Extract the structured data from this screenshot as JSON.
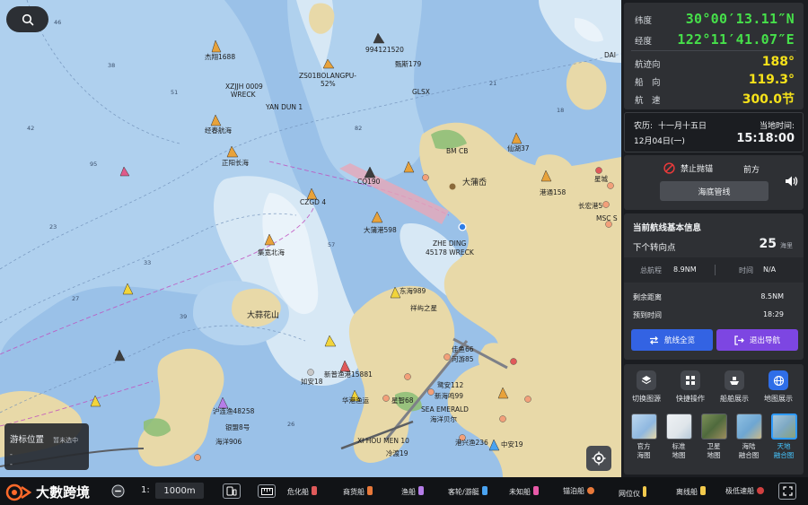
{
  "cursor_box": {
    "title": "游标位置",
    "status": "暂未选中",
    "line1": "-",
    "line2": "-"
  },
  "position": {
    "lat_label": "纬度",
    "lat_value": "30°00′13.11″N",
    "lon_label": "经度",
    "lon_value": "122°11′41.07″E"
  },
  "motion": {
    "track_label": "航迹向",
    "track_value": "188°",
    "heading_label": "船　向",
    "heading_value": "119.3°",
    "speed_label": "航　速",
    "speed_value": "300.0节"
  },
  "datetime": {
    "lunar_label": "农历:",
    "lunar_value": "十一月十五日",
    "date_value": "12月04日(一)",
    "local_label": "当地时间:",
    "time_value": "15:18:00"
  },
  "warning": {
    "no_anchor_label": "禁止抛锚",
    "ahead_label": "前方",
    "pipeline_label": "海底管线"
  },
  "route": {
    "title": "当前航线基本信息",
    "next_turn_label": "下个转向点",
    "next_turn_value": "25",
    "next_turn_unit": "海里",
    "total_label": "总航程",
    "total_value": "8.9NM",
    "time_label": "时间",
    "time_value": "N/A",
    "remaining_label": "剩余距离",
    "remaining_value": "8.5NM",
    "eta_label": "预到时间",
    "eta_value": "18:29",
    "overview_button": "航线全览",
    "exit_button": "退出导航"
  },
  "tools": [
    {
      "label": "切换图源",
      "icon": "layers-icon"
    },
    {
      "label": "快捷操作",
      "icon": "grid-icon"
    },
    {
      "label": "船舶展示",
      "icon": "ship-icon"
    },
    {
      "label": "地图展示",
      "icon": "globe-icon"
    }
  ],
  "map_styles": [
    {
      "line1": "官方",
      "line2": "海图",
      "color": "#a6c8e8"
    },
    {
      "line1": "标准",
      "line2": "地图",
      "color": "#dfe5ea"
    },
    {
      "line1": "卫星",
      "line2": "地图",
      "color": "#5e7a4a"
    },
    {
      "line1": "海陆",
      "line2": "融合图",
      "color": "#7fb3d8"
    },
    {
      "line1": "天地",
      "line2": "融合图",
      "color": "#8fb6cf"
    }
  ],
  "bottom": {
    "brand": "大數跨境",
    "scale_prefix": "1:",
    "scale_value": "1000m",
    "legend": [
      {
        "label": "危化船",
        "color": "#e05a5a"
      },
      {
        "label": "商货船",
        "color": "#e8793a"
      },
      {
        "label": "渔船",
        "color": "#b57de8"
      },
      {
        "label": "客轮/游艇",
        "color": "#4aa3f0"
      },
      {
        "label": "未知船",
        "color": "#e85aa8"
      },
      {
        "label": "锚泊船",
        "color": "#e8793a"
      },
      {
        "label": "网位仪",
        "color": "#f2c94c"
      },
      {
        "label": "离线船",
        "color": "#f2c94c"
      },
      {
        "label": "极低速船",
        "color": "#d04040"
      }
    ]
  },
  "map_labels": [
    "杰翔1688",
    "XZJJH 0009",
    "WRECK",
    "YAN DUN 1",
    "ZS01BOLANGPU-",
    "52%",
    "994121520",
    "甄斯179",
    "GLSX",
    "经春航海",
    "正阳长海",
    "CQ190",
    "CZGD 4",
    "BM CB",
    "大蒲岙",
    "仙湖37",
    "集宽北海",
    "大蒲港598",
    "ZHE DING",
    "45178 WRECK",
    "东海989",
    "祥屿之星",
    "大蒜花山",
    "新普渔港15881",
    "如安18",
    "华港渔运",
    "星智68",
    "沪连渔48258",
    "银盟8号",
    "海洋906",
    "佳鱼66",
    "河游85",
    "鹭安112",
    "新海鸣99",
    "SEA EMERALD",
    "海洋贝尔",
    "XI HOU MEN 10",
    "冷渡19",
    "港兴渔236",
    "中安19",
    "港通158",
    "长宏港5",
    "MSC S",
    "DAI",
    "星城"
  ]
}
